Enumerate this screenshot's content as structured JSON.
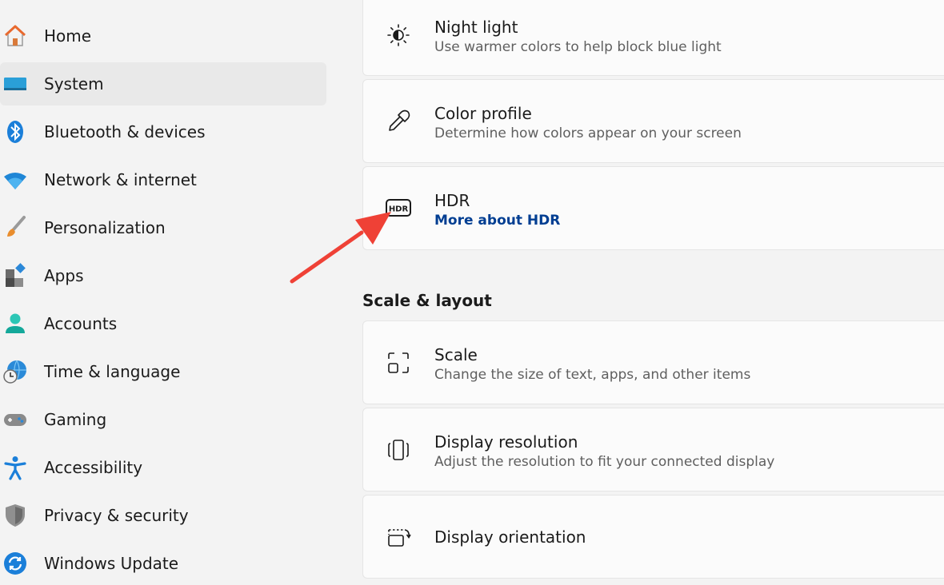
{
  "sidebar": {
    "items": [
      {
        "label": "Home",
        "icon": "home-icon"
      },
      {
        "label": "System",
        "icon": "system-icon",
        "selected": true
      },
      {
        "label": "Bluetooth & devices",
        "icon": "bluetooth-icon"
      },
      {
        "label": "Network & internet",
        "icon": "wifi-icon"
      },
      {
        "label": "Personalization",
        "icon": "brush-icon"
      },
      {
        "label": "Apps",
        "icon": "apps-icon"
      },
      {
        "label": "Accounts",
        "icon": "person-icon"
      },
      {
        "label": "Time & language",
        "icon": "globe-clock-icon"
      },
      {
        "label": "Gaming",
        "icon": "gamepad-icon"
      },
      {
        "label": "Accessibility",
        "icon": "accessibility-icon"
      },
      {
        "label": "Privacy & security",
        "icon": "shield-icon"
      },
      {
        "label": "Windows Update",
        "icon": "update-icon"
      }
    ]
  },
  "content": {
    "cards": [
      {
        "title": "Night light",
        "subtitle": "Use warmer colors to help block blue light",
        "icon": "night-light-icon"
      },
      {
        "title": "Color profile",
        "subtitle": "Determine how colors appear on your screen",
        "icon": "eyedropper-icon"
      },
      {
        "title": "HDR",
        "link": "More about HDR",
        "icon": "hdr-icon"
      }
    ],
    "section_scale": "Scale & layout",
    "scale_cards": [
      {
        "title": "Scale",
        "subtitle": "Change the size of text, apps, and other items",
        "icon": "scale-icon"
      },
      {
        "title": "Display resolution",
        "subtitle": "Adjust the resolution to fit your connected display",
        "icon": "resolution-icon"
      },
      {
        "title": "Display orientation",
        "icon": "orientation-icon"
      }
    ]
  },
  "colors": {
    "accent": "#005fb8",
    "link": "#003e92",
    "annotation_arrow": "#ef4136"
  }
}
